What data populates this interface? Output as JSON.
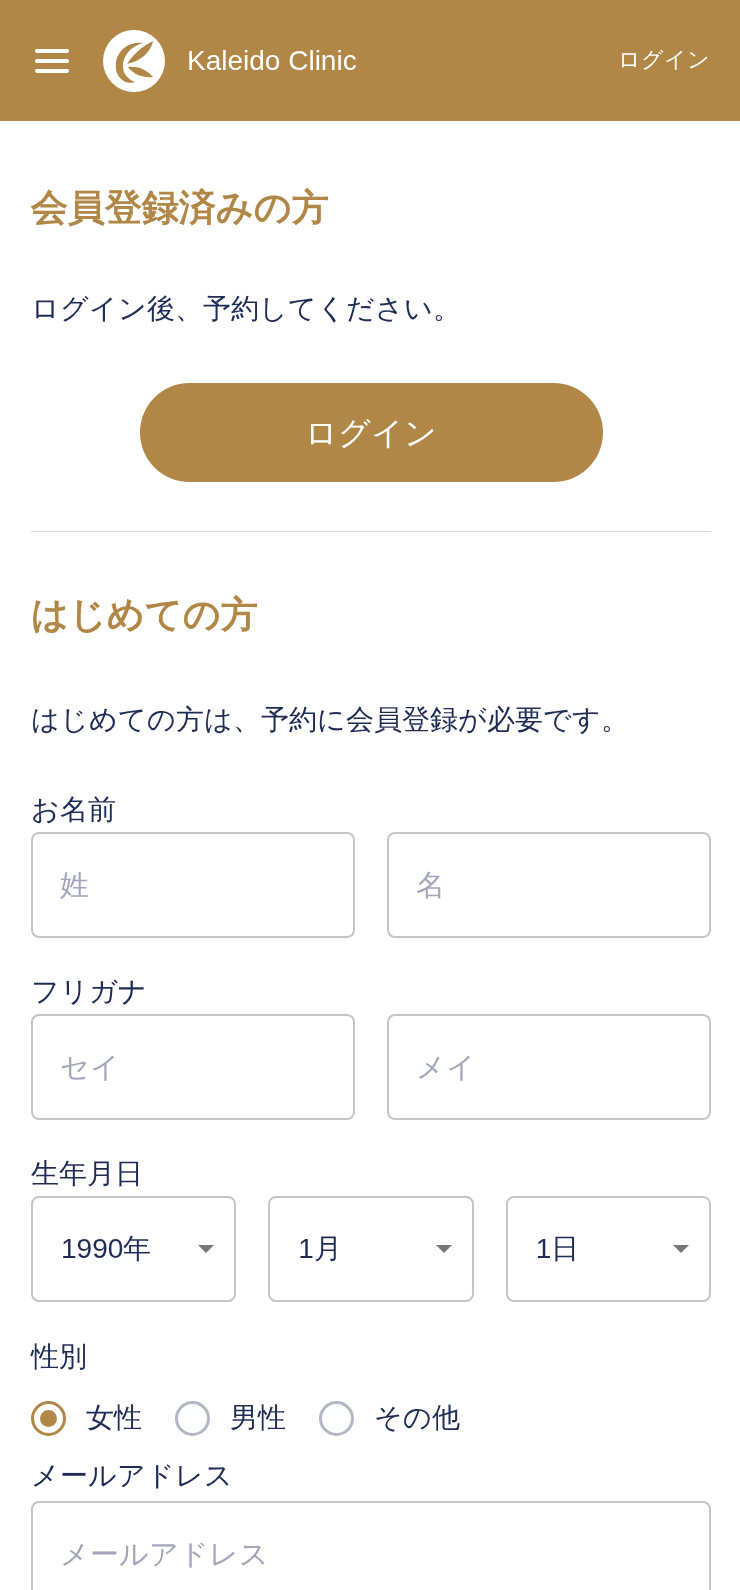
{
  "header": {
    "brand": "Kaleido Clinic",
    "login_link": "ログイン"
  },
  "member_section": {
    "heading": "会員登録済みの方",
    "text": "ログイン後、予約してください。",
    "login_button": "ログイン"
  },
  "signup_section": {
    "heading": "はじめての方",
    "text": "はじめての方は、予約に会員登録が必要です。",
    "fields": [
      {
        "kind": "pair",
        "label": "お名前",
        "inputs": [
          {
            "placeholder": "姓"
          },
          {
            "placeholder": "名"
          }
        ]
      },
      {
        "kind": "pair",
        "label": "フリガナ",
        "inputs": [
          {
            "placeholder": "セイ"
          },
          {
            "placeholder": "メイ"
          }
        ]
      },
      {
        "kind": "selects",
        "label": "生年月日",
        "selects": [
          {
            "value": "1990年"
          },
          {
            "value": "1月"
          },
          {
            "value": "1日"
          }
        ]
      },
      {
        "kind": "radios",
        "label": "性別",
        "options": [
          {
            "label": "女性",
            "selected": true
          },
          {
            "label": "男性",
            "selected": false
          },
          {
            "label": "その他",
            "selected": false
          }
        ]
      },
      {
        "kind": "text",
        "label": "メールアドレス",
        "placeholder": "メールアドレス"
      }
    ]
  }
}
